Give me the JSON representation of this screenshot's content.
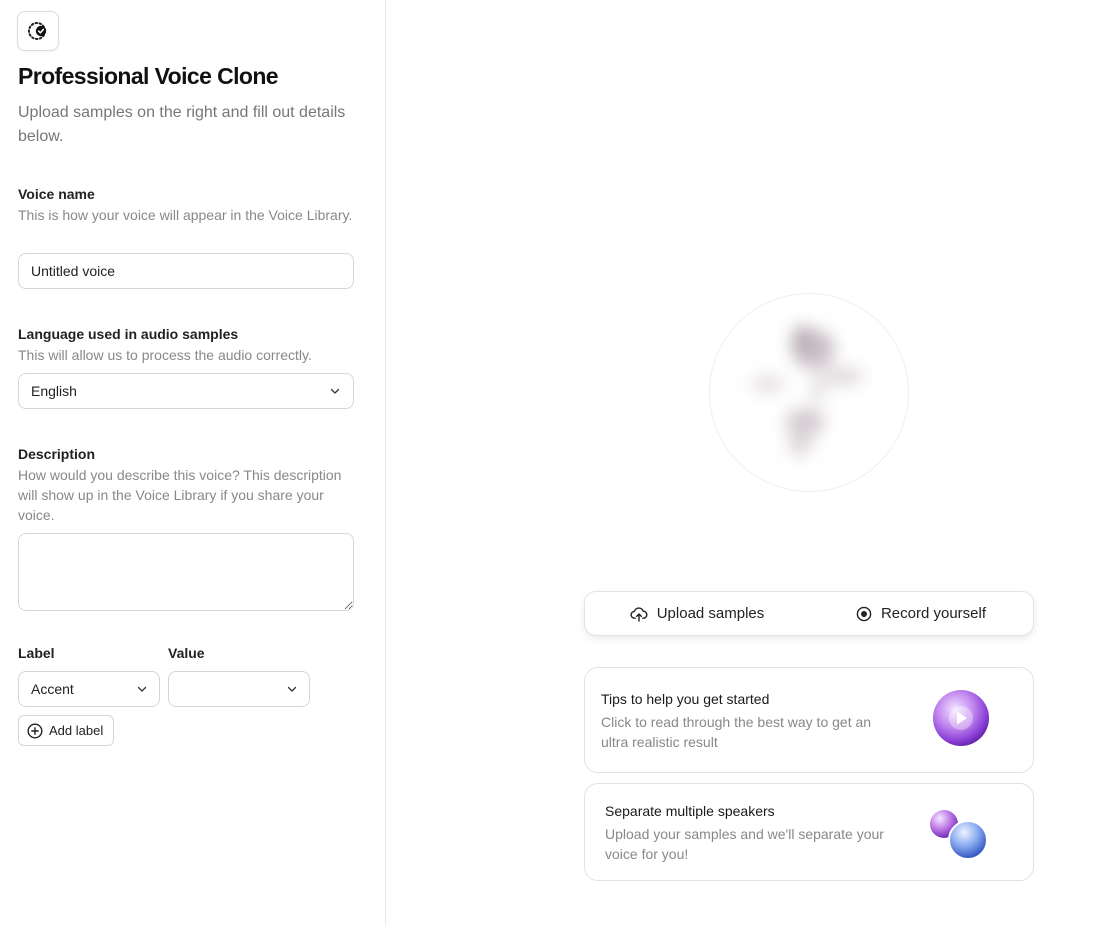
{
  "header": {
    "title": "Professional Voice Clone",
    "subtitle": "Upload samples on the right and fill out details below."
  },
  "voice_name": {
    "label": "Voice name",
    "help": "This is how your voice will appear in the Voice Library.",
    "value": "Untitled voice"
  },
  "language": {
    "label": "Language used in audio samples",
    "help": "This will allow us to process the audio correctly.",
    "selected": "English"
  },
  "description": {
    "label": "Description",
    "help": "How would you describe this voice? This description will show up in the Voice Library if you share your voice.",
    "value": ""
  },
  "labels": {
    "label_header": "Label",
    "value_header": "Value",
    "label_selected": "Accent",
    "value_selected": "",
    "add_button": "Add label"
  },
  "actions": {
    "upload": "Upload samples",
    "record": "Record yourself"
  },
  "cards": [
    {
      "title": "Tips to help you get started",
      "description": "Click to read through the best way to get an ultra realistic result",
      "icon": "play-orb-icon"
    },
    {
      "title": "Separate multiple speakers",
      "description": "Upload your samples and we'll separate your voice for you!",
      "icon": "speakers-orb-icon"
    }
  ],
  "colors": {
    "accent_purple": "#a855f7",
    "accent_blue": "#4f7be8",
    "muted_text": "#888888",
    "border": "#d6d6d6"
  }
}
